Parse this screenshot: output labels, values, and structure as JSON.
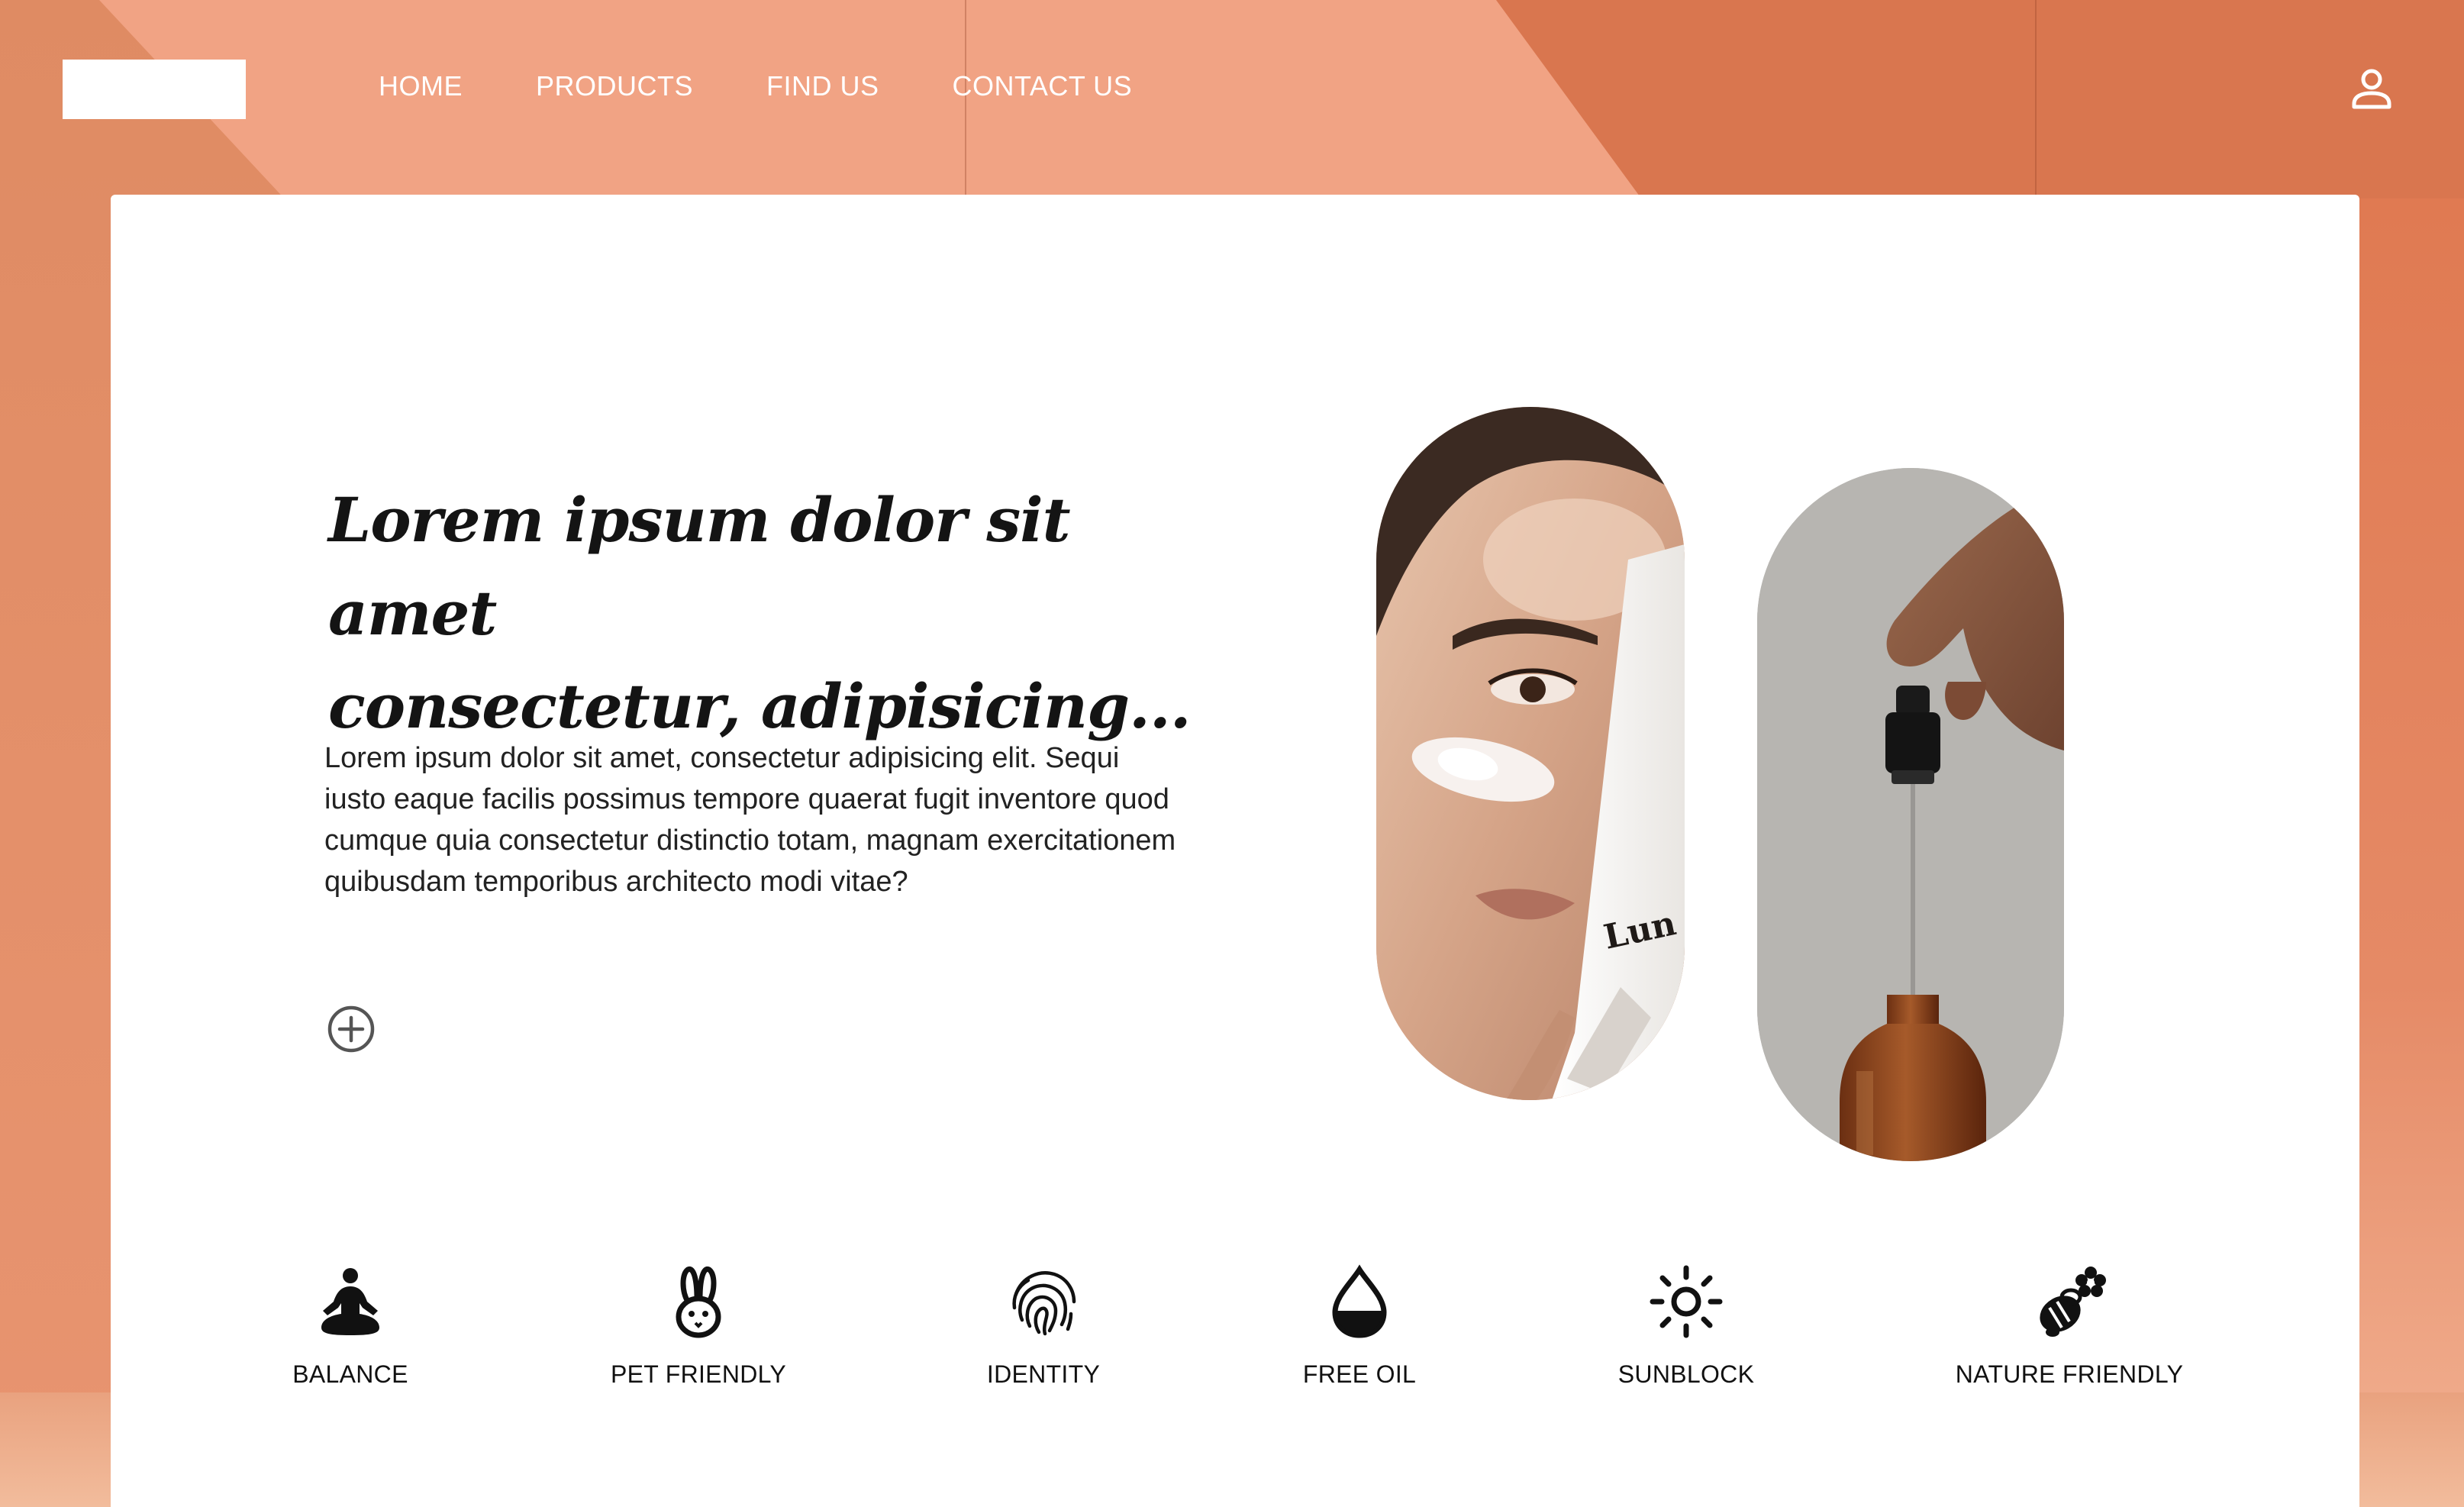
{
  "nav": {
    "items": [
      {
        "label": "HOME"
      },
      {
        "label": "PRODUCTS"
      },
      {
        "label": "FIND US"
      },
      {
        "label": "CONTACT US"
      }
    ]
  },
  "header": {
    "account_icon": "user-icon"
  },
  "hero": {
    "title_line1": "Lorem ipsum dolor sit amet",
    "title_line2": "consectetur, adipisicing...",
    "body": "Lorem ipsum dolor sit amet, consectetur adipisicing elit. Sequi iusto eaque facilis possimus tempore quaerat fugit inventore quod cumque quia consectetur distinctio totam, magnam exercitationem quibusdam temporibus architecto modi vitae?",
    "expand_icon": "plus-circle-icon"
  },
  "images": {
    "face_tube_label": "Lun"
  },
  "features": [
    {
      "label": "BALANCE",
      "icon": "meditation-icon"
    },
    {
      "label": "PET FRIENDLY",
      "icon": "rabbit-icon"
    },
    {
      "label": "IDENTITY",
      "icon": "fingerprint-icon"
    },
    {
      "label": "FREE OIL",
      "icon": "oil-drop-icon"
    },
    {
      "label": "SUNBLOCK",
      "icon": "sun-icon"
    },
    {
      "label": "NATURE FRIENDLY",
      "icon": "bee-flower-icon"
    }
  ],
  "colors": {
    "background": "#e08a63",
    "card": "#ffffff",
    "text": "#141414"
  }
}
